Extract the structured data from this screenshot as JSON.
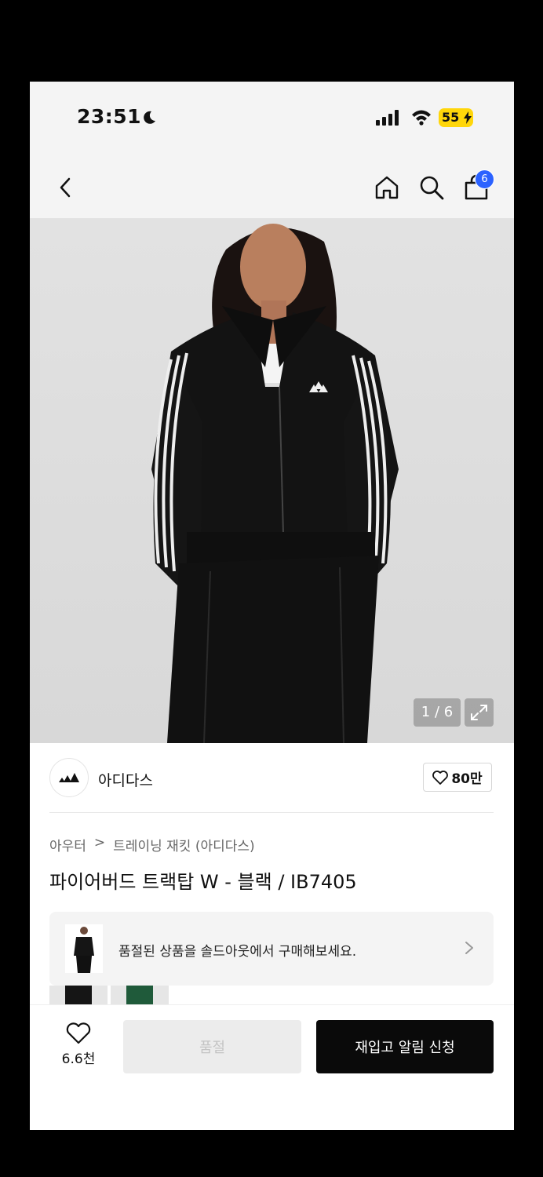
{
  "status_bar": {
    "time": "23:51",
    "battery": "55",
    "icons": [
      "moon-icon",
      "signal-icon",
      "wifi-icon",
      "battery-icon"
    ]
  },
  "nav": {
    "icons": [
      "back-icon",
      "home-icon",
      "search-icon",
      "bag-icon"
    ],
    "cart_count": "6"
  },
  "gallery": {
    "counter": "1 / 6",
    "expand_icon": "expand-icon"
  },
  "brand": {
    "name": "아디다스",
    "likes": "80만"
  },
  "breadcrumb": {
    "category": "아우터",
    "separator": ">",
    "subcategory": "트레이닝 재킷 (아디다스)"
  },
  "product": {
    "title": "파이어버드 트랙탑 W - 블랙 / IB7405"
  },
  "soldout_banner": {
    "text": "품절된 상품을 솔드아웃에서 구매해보세요."
  },
  "bottom_bar": {
    "wish_count": "6.6천",
    "soldout_label": "품절",
    "restock_label": "재입고 알림 신청"
  },
  "colors": {
    "accent_badge": "#2b62ff",
    "battery": "#ffd60a",
    "primary_button": "#0a0a0a",
    "disabled_button": "#ececec"
  }
}
